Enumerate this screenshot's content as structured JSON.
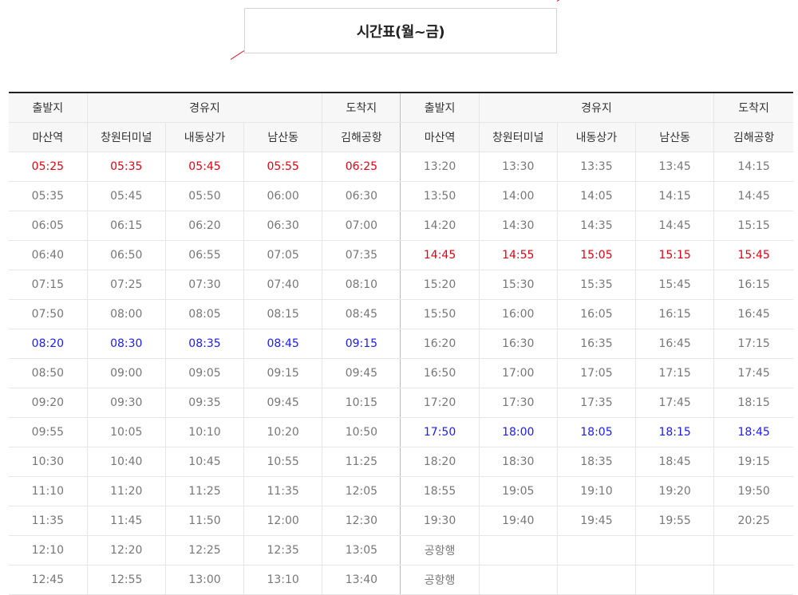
{
  "page": {
    "title": "시간표(월~금)",
    "accent_color": "#e60012",
    "highlight_red": "#e60012",
    "highlight_blue": "#1a1aff"
  },
  "header": {
    "group": [
      "출발지",
      "경유지",
      "도착지",
      "출발지",
      "경유지",
      "도착지"
    ],
    "stops": [
      "마산역",
      "창원터미널",
      "내동상가",
      "남산동",
      "김해공항",
      "마산역",
      "창원터미널",
      "내동상가",
      "남산동",
      "김해공항"
    ]
  },
  "rows": [
    {
      "left": [
        "05:25",
        "05:35",
        "05:45",
        "05:55",
        "06:25"
      ],
      "right": [
        "13:20",
        "13:30",
        "13:35",
        "13:45",
        "14:15"
      ],
      "lh": "red",
      "rh": ""
    },
    {
      "left": [
        "05:35",
        "05:45",
        "05:50",
        "06:00",
        "06:30"
      ],
      "right": [
        "13:50",
        "14:00",
        "14:05",
        "14:15",
        "14:45"
      ],
      "lh": "",
      "rh": ""
    },
    {
      "left": [
        "06:05",
        "06:15",
        "06:20",
        "06:30",
        "07:00"
      ],
      "right": [
        "14:20",
        "14:30",
        "14:35",
        "14:45",
        "15:15"
      ],
      "lh": "",
      "rh": ""
    },
    {
      "left": [
        "06:40",
        "06:50",
        "06:55",
        "07:05",
        "07:35"
      ],
      "right": [
        "14:45",
        "14:55",
        "15:05",
        "15:15",
        "15:45"
      ],
      "lh": "",
      "rh": "red"
    },
    {
      "left": [
        "07:15",
        "07:25",
        "07:30",
        "07:40",
        "08:10"
      ],
      "right": [
        "15:20",
        "15:30",
        "15:35",
        "15:45",
        "16:15"
      ],
      "lh": "",
      "rh": ""
    },
    {
      "left": [
        "07:50",
        "08:00",
        "08:05",
        "08:15",
        "08:45"
      ],
      "right": [
        "15:50",
        "16:00",
        "16:05",
        "16:15",
        "16:45"
      ],
      "lh": "",
      "rh": ""
    },
    {
      "left": [
        "08:20",
        "08:30",
        "08:35",
        "08:45",
        "09:15"
      ],
      "right": [
        "16:20",
        "16:30",
        "16:35",
        "16:45",
        "17:15"
      ],
      "lh": "blue",
      "rh": ""
    },
    {
      "left": [
        "08:50",
        "09:00",
        "09:05",
        "09:15",
        "09:45"
      ],
      "right": [
        "16:50",
        "17:00",
        "17:05",
        "17:15",
        "17:45"
      ],
      "lh": "",
      "rh": ""
    },
    {
      "left": [
        "09:20",
        "09:30",
        "09:35",
        "09:45",
        "10:15"
      ],
      "right": [
        "17:20",
        "17:30",
        "17:35",
        "17:45",
        "18:15"
      ],
      "lh": "",
      "rh": ""
    },
    {
      "left": [
        "09:55",
        "10:05",
        "10:10",
        "10:20",
        "10:50"
      ],
      "right": [
        "17:50",
        "18:00",
        "18:05",
        "18:15",
        "18:45"
      ],
      "lh": "",
      "rh": "blue"
    },
    {
      "left": [
        "10:30",
        "10:40",
        "10:45",
        "10:55",
        "11:25"
      ],
      "right": [
        "18:20",
        "18:30",
        "18:35",
        "18:45",
        "19:15"
      ],
      "lh": "",
      "rh": ""
    },
    {
      "left": [
        "11:10",
        "11:20",
        "11:25",
        "11:35",
        "12:05"
      ],
      "right": [
        "18:55",
        "19:05",
        "19:10",
        "19:20",
        "19:50"
      ],
      "lh": "",
      "rh": ""
    },
    {
      "left": [
        "11:35",
        "11:45",
        "11:50",
        "12:00",
        "12:30"
      ],
      "right": [
        "19:30",
        "19:40",
        "19:45",
        "19:55",
        "20:25"
      ],
      "lh": "",
      "rh": ""
    },
    {
      "left": [
        "12:10",
        "12:20",
        "12:25",
        "12:35",
        "13:05"
      ],
      "right": [
        "공항행",
        "",
        "",
        "",
        ""
      ],
      "lh": "",
      "rh": ""
    },
    {
      "left": [
        "12:45",
        "12:55",
        "13:00",
        "13:10",
        "13:40"
      ],
      "right": [
        "공항행",
        "",
        "",
        "",
        ""
      ],
      "lh": "",
      "rh": ""
    }
  ]
}
